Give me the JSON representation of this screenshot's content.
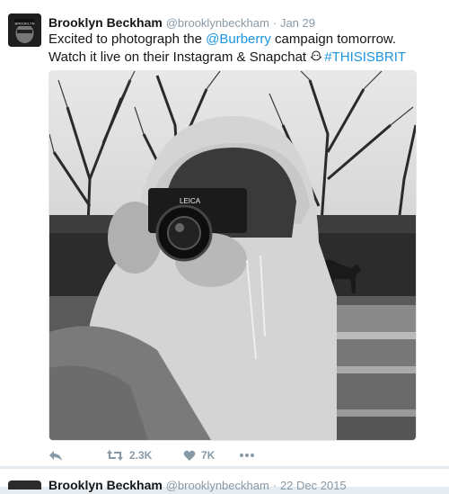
{
  "tweet": {
    "author_name": "Brooklyn Beckham",
    "handle": "@brooklynbeckham",
    "separator": "·",
    "date": "Jan 29",
    "text_part1": "Excited to photograph the ",
    "mention": "@Burberry",
    "text_part2": " campaign tomorrow. Watch it live on their Instagram & Snapchat ",
    "hashtag": "#THISISBRIT",
    "retweet_count": "2.3K",
    "like_count": "7K",
    "camera_brand": "LEICA",
    "avatar_text": "BROOKLYN"
  },
  "next_tweet": {
    "author_name": "Brooklyn Beckham",
    "handle": "@brooklynbeckham",
    "separator": "·",
    "date": "22 Dec 2015"
  },
  "colors": {
    "link": "#1b95e0",
    "meta": "#8899a6",
    "text": "#14171a"
  }
}
